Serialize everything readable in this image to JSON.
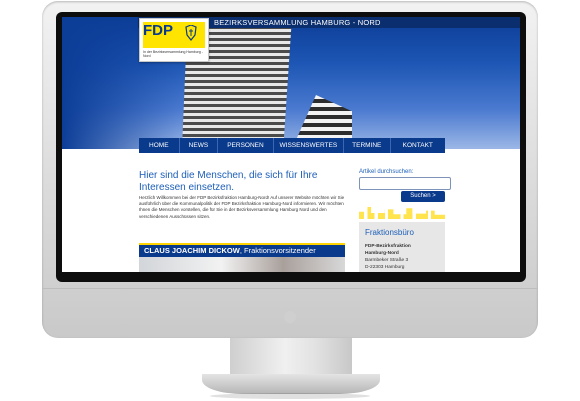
{
  "site": {
    "title": "BEZIRKSVERSAMMLUNG HAMBURG - NORD",
    "logo_text": "FDP",
    "logo_subtitle": "In der Bezirksversammlung Hamburg -Nord"
  },
  "nav": {
    "items": [
      {
        "label": "HOME"
      },
      {
        "label": "NEWS"
      },
      {
        "label": "PERSONEN"
      },
      {
        "label": "WISSENSWERTES"
      },
      {
        "label": "TERMINE"
      },
      {
        "label": "KONTAKT"
      }
    ]
  },
  "main": {
    "headline": "Hier sind die Menschen, die sich für Ihre Interessen einsetzen.",
    "intro": "Herzlich Willkommen bei der FDP Bezirksfraktion Hamburg-Nord! Auf unserer Website möchten wir Sie ausführlich über die Kommunalpolitik der FDP Bezirksfraktion Hamburg-Nord informieren. Wir möchten Ihnen die Menschen vorstellen, die für Sie in der Bezirksversammlung Hamburg Nord und den verschiedenen Ausschüssen sitzen.",
    "section_name": "CLAUS JOACHIM DICKOW",
    "section_role": ", Fraktionsvorsitzender"
  },
  "sidebar": {
    "search_label": "Artikel durchsuchen:",
    "search_value": "",
    "search_button": "Suchen >",
    "office_title": "Fraktionsbüro",
    "office_lines": [
      "FDP-Bezirksfraktion",
      "Hamburg-Nord",
      "Barmbeker Straße 3",
      "D-22303 Hamburg"
    ]
  },
  "colors": {
    "brand_blue": "#0a3a8c",
    "brand_yellow": "#ffe400",
    "link_blue": "#1d5fb8"
  }
}
